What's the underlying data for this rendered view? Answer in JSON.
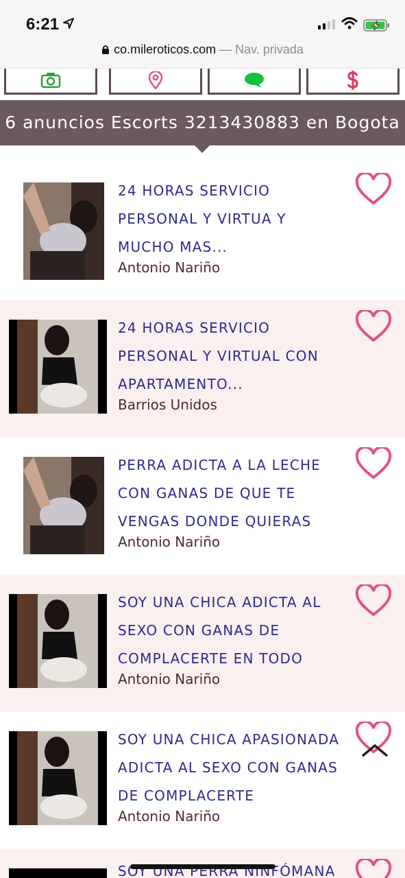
{
  "status": {
    "time": "6:21",
    "url": "co.mileroticos.com",
    "url_suffix": " — Nav. privada"
  },
  "tiles": [
    {
      "icon": "camera-icon",
      "color": "#2e9e3e"
    },
    {
      "icon": "map-pin-icon",
      "color": "#e0557a"
    },
    {
      "icon": "chat-icon",
      "color": "#11c23c"
    },
    {
      "icon": "dollar-icon",
      "color": "#e03a62"
    }
  ],
  "header": {
    "title": "6 anuncios Escorts 3213430883 en Bogota"
  },
  "listings": [
    {
      "title": "24 HORAS SERVICIO PERSONAL Y VIRTUA Y MUCHO MAS...",
      "location": "Antonio Nariño"
    },
    {
      "title": "24 HORAS SERVICIO PERSONAL Y VIRTUAL CON APARTAMENTO...",
      "location": "Barrios Unidos"
    },
    {
      "title": "PERRA ADICTA A LA LECHE CON GANAS DE QUE TE VENGAS DONDE QUIERAS",
      "location": "Antonio Nariño"
    },
    {
      "title": "SOY UNA CHICA ADICTA AL SEXO CON GANAS DE COMPLACERTE EN TODO",
      "location": "Antonio Nariño"
    },
    {
      "title": "SOY UNA CHICA APASIONADA ADICTA AL SEXO CON GANAS DE COMPLACERTE",
      "location": "Antonio Nariño"
    }
  ],
  "partial_listing": {
    "title": "SOY UNA PERRA NINFÓMANA"
  },
  "colors": {
    "banner": "#6b5960",
    "title": "#2b2a8c",
    "heart": "#e0557a",
    "alt_row": "#fbf0f0"
  }
}
